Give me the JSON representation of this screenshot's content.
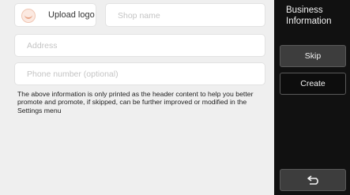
{
  "form": {
    "upload_logo_label": "Upload logo",
    "shop_name_placeholder": "Shop name",
    "address_placeholder": "Address",
    "phone_placeholder": "Phone number (optional)",
    "info_text": "The above information is only printed as the header content to help you better promote and promote, if skipped, can be further improved or modified in the Settings menu"
  },
  "sidebar": {
    "title": "Business Information",
    "skip_label": "Skip",
    "create_label": "Create",
    "back_icon": "back-arrow-icon"
  },
  "colors": {
    "sidebar_bg": "#111111",
    "main_bg": "#efefef",
    "button_bg": "#3d3d3d"
  }
}
